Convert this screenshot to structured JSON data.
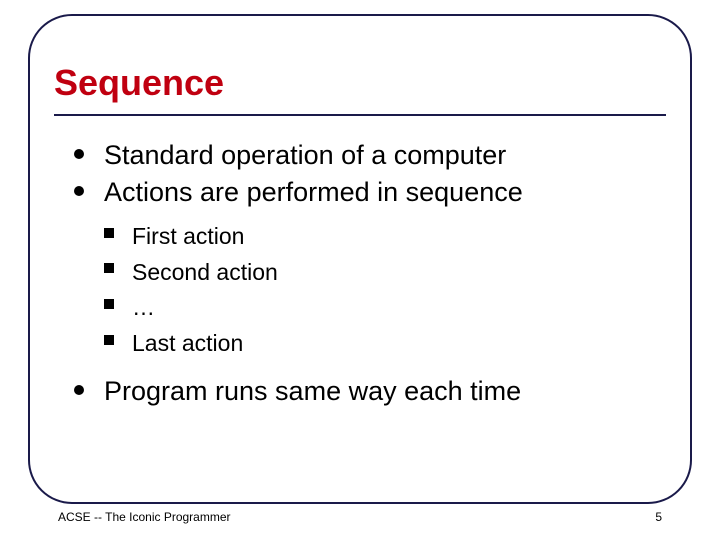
{
  "colors": {
    "heading": "#c00010",
    "border": "#1a1a4a"
  },
  "title": "Sequence",
  "bullets": {
    "l1": [
      "Standard operation of a computer",
      "Actions are performed in sequence",
      "Program runs same way each time"
    ],
    "l2": [
      "First action",
      "Second action",
      "…",
      "Last action"
    ]
  },
  "footer": {
    "left": "ACSE -- The Iconic Programmer",
    "right": "5"
  }
}
